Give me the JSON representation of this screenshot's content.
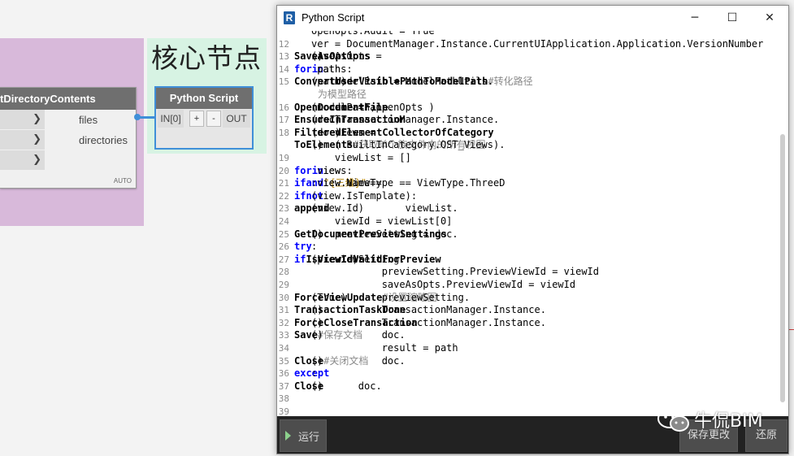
{
  "canvas": {
    "group_title": "核心节点",
    "dir_node": {
      "title": "GetDirectoryContents",
      "title_visible": "tDirectoryContents",
      "input_arrow": "❯",
      "outputs": [
        "files",
        "directories"
      ],
      "lacing": "AUTO"
    },
    "py_node": {
      "title": "Python Script",
      "input": "IN[0]",
      "plus": "+",
      "minus": "-",
      "output": "OUT"
    }
  },
  "window": {
    "title": "Python Script",
    "app_icon": "R",
    "controls": {
      "minimize": "─",
      "maximize": "☐",
      "close": "✕"
    }
  },
  "editor": {
    "lines": [
      {
        "n": "",
        "segs": [
          {
            "t": "openOpts.Audit = True",
            "c": "txt"
          }
        ]
      },
      {
        "n": "12",
        "segs": [
          {
            "t": "ver = DocumentManager.Instance.CurrentUIApplication.Application.VersionNumber",
            "c": "txt"
          }
        ]
      },
      {
        "n": "13",
        "segs": [
          {
            "t": "saveAsOpts = ",
            "c": "txt"
          },
          {
            "t": "SaveAsOptions",
            "c": "fn"
          },
          {
            "t": "()",
            "c": "txt"
          }
        ]
      },
      {
        "n": "14",
        "segs": [
          {
            "t": "for",
            "c": "kw"
          },
          {
            "t": " path ",
            "c": "txt"
          },
          {
            "t": "in",
            "c": "kw"
          },
          {
            "t": " paths:",
            "c": "txt"
          }
        ]
      },
      {
        "n": "15",
        "segs": [
          {
            "t": "    modelPath = ModelPathUtils.",
            "c": "txt"
          },
          {
            "t": "ConvertUserVisiblePathToModelPath",
            "c": "fn"
          },
          {
            "t": "(path) ",
            "c": "txt"
          },
          {
            "t": "#转化路径",
            "c": "cm"
          }
        ]
      },
      {
        "n": "",
        "segs": [
          {
            "t": "    为模型路径",
            "c": "cm"
          }
        ]
      },
      {
        "n": "16",
        "segs": [
          {
            "t": "    doc = app.",
            "c": "txt"
          },
          {
            "t": "OpenDocumentFile",
            "c": "fn"
          },
          {
            "t": "(modelPath,openOpts )",
            "c": "txt"
          }
        ]
      },
      {
        "n": "17",
        "segs": [
          {
            "t": "    TransactionManager.Instance.",
            "c": "txt"
          },
          {
            "t": "EnsureInTransaction",
            "c": "fn"
          },
          {
            "t": "(doc)",
            "c": "txt"
          }
        ]
      },
      {
        "n": "18",
        "segs": [
          {
            "t": "    views = ",
            "c": "txt"
          },
          {
            "t": "FilteredElementCollector",
            "c": "fn"
          },
          {
            "t": "(doc).",
            "c": "txt"
          },
          {
            "t": "OfCategory",
            "c": "fn"
          }
        ]
      },
      {
        "n": "",
        "segs": [
          {
            "t": "    ( BuiltInCategory.OST_Views).",
            "c": "txt"
          },
          {
            "t": "ToElements",
            "c": "fn"
          },
          {
            "t": "() ",
            "c": "txt"
          },
          {
            "t": "#获取单个族文件内的所有视图",
            "c": "cm"
          }
        ]
      },
      {
        "n": "19",
        "segs": [
          {
            "t": "    viewList = []",
            "c": "txt"
          }
        ]
      },
      {
        "n": "20",
        "segs": [
          {
            "t": "    ",
            "c": "txt"
          },
          {
            "t": "for",
            "c": "kw"
          },
          {
            "t": " view ",
            "c": "txt"
          },
          {
            "t": "in",
            "c": "kw"
          },
          {
            "t": " views:",
            "c": "txt"
          }
        ]
      },
      {
        "n": "21",
        "segs": [
          {
            "t": "        ",
            "c": "txt"
          },
          {
            "t": "if",
            "c": "kw"
          },
          {
            "t": " view.ViewType == ViewType.ThreeD ",
            "c": "txt"
          },
          {
            "t": "and",
            "c": "kw"
          },
          {
            "t": " view.Name==",
            "c": "txt"
          },
          {
            "t": "\"{三维}\"",
            "c": "st"
          },
          {
            "t": ":",
            "c": "txt"
          }
        ]
      },
      {
        "n": "22",
        "segs": [
          {
            "t": "            ",
            "c": "txt"
          },
          {
            "t": "if",
            "c": "kw"
          },
          {
            "t": " ",
            "c": "txt"
          },
          {
            "t": "not",
            "c": "kw"
          },
          {
            "t": "(view.IsTemplate):",
            "c": "txt"
          }
        ]
      },
      {
        "n": "23",
        "segs": [
          {
            "t": "                viewList.",
            "c": "txt"
          },
          {
            "t": "append",
            "c": "fn"
          },
          {
            "t": "(view.Id)",
            "c": "txt"
          }
        ]
      },
      {
        "n": "24",
        "segs": [
          {
            "t": "    viewId = viewList[0]",
            "c": "txt"
          }
        ]
      },
      {
        "n": "25",
        "segs": [
          {
            "t": "    previewSetting = doc.",
            "c": "txt"
          },
          {
            "t": "GetDocumentPreviewSettings",
            "c": "fn"
          },
          {
            "t": "()",
            "c": "txt"
          }
        ]
      },
      {
        "n": "26",
        "segs": [
          {
            "t": "    ",
            "c": "txt"
          },
          {
            "t": "try",
            "c": "kw"
          },
          {
            "t": ":",
            "c": "txt"
          }
        ]
      },
      {
        "n": "27",
        "segs": [
          {
            "t": "        ",
            "c": "txt"
          },
          {
            "t": "if",
            "c": "kw"
          },
          {
            "t": " previewSetting.",
            "c": "txt"
          },
          {
            "t": "IsViewIdValidForPreview",
            "c": "fn"
          },
          {
            "t": "(viewId):",
            "c": "txt"
          }
        ]
      },
      {
        "n": "28",
        "segs": [
          {
            "t": "            previewSetting.PreviewViewId = viewId",
            "c": "txt"
          }
        ]
      },
      {
        "n": "29",
        "segs": [
          {
            "t": "            saveAsOpts.PreviewViewId = viewId",
            "c": "txt"
          }
        ]
      },
      {
        "n": "30",
        "segs": [
          {
            "t": "            previewSetting.",
            "c": "txt"
          },
          {
            "t": "ForceViewUpdate",
            "c": "fn"
          },
          {
            "t": "(True) ",
            "c": "txt"
          },
          {
            "t": "#设置缩略图",
            "c": "cm"
          }
        ]
      },
      {
        "n": "31",
        "segs": [
          {
            "t": "            TransactionManager.Instance.",
            "c": "txt"
          },
          {
            "t": "TransactionTaskDone",
            "c": "fn"
          },
          {
            "t": "()",
            "c": "txt"
          }
        ]
      },
      {
        "n": "32",
        "segs": [
          {
            "t": "            TransactionManager.Instance.",
            "c": "txt"
          },
          {
            "t": "ForceCloseTransaction",
            "c": "fn"
          },
          {
            "t": "()",
            "c": "txt"
          }
        ]
      },
      {
        "n": "33",
        "segs": [
          {
            "t": "            doc.",
            "c": "txt"
          },
          {
            "t": "Save",
            "c": "fn"
          },
          {
            "t": "()",
            "c": "txt"
          },
          {
            "t": "#保存文档",
            "c": "cm"
          }
        ]
      },
      {
        "n": "34",
        "segs": [
          {
            "t": "            result = path",
            "c": "txt"
          }
        ]
      },
      {
        "n": "35",
        "segs": [
          {
            "t": "            doc.",
            "c": "txt"
          },
          {
            "t": "Close",
            "c": "fn"
          },
          {
            "t": "()",
            "c": "txt"
          },
          {
            "t": "#关闭文档",
            "c": "cm"
          }
        ]
      },
      {
        "n": "36",
        "segs": [
          {
            "t": "    ",
            "c": "txt"
          },
          {
            "t": "except",
            "c": "kw"
          },
          {
            "t": ":",
            "c": "txt"
          }
        ]
      },
      {
        "n": "37",
        "segs": [
          {
            "t": "        doc.",
            "c": "txt"
          },
          {
            "t": "Close",
            "c": "fn"
          },
          {
            "t": "()",
            "c": "txt"
          }
        ]
      },
      {
        "n": "38",
        "segs": []
      },
      {
        "n": "39",
        "segs": []
      }
    ]
  },
  "footer": {
    "run_label": "运行",
    "save_label": "保存更改",
    "revert_label": "还原"
  },
  "watermark": {
    "text": "牛侃BIM"
  },
  "colors": {
    "keyword": "#0000ff",
    "comment": "#8a8a8a",
    "string": "#b8860b",
    "wire": "#3f8fd8",
    "group_purple": "#d8b9da",
    "group_green": "#d7f3e3",
    "footer_bg": "#222222"
  }
}
